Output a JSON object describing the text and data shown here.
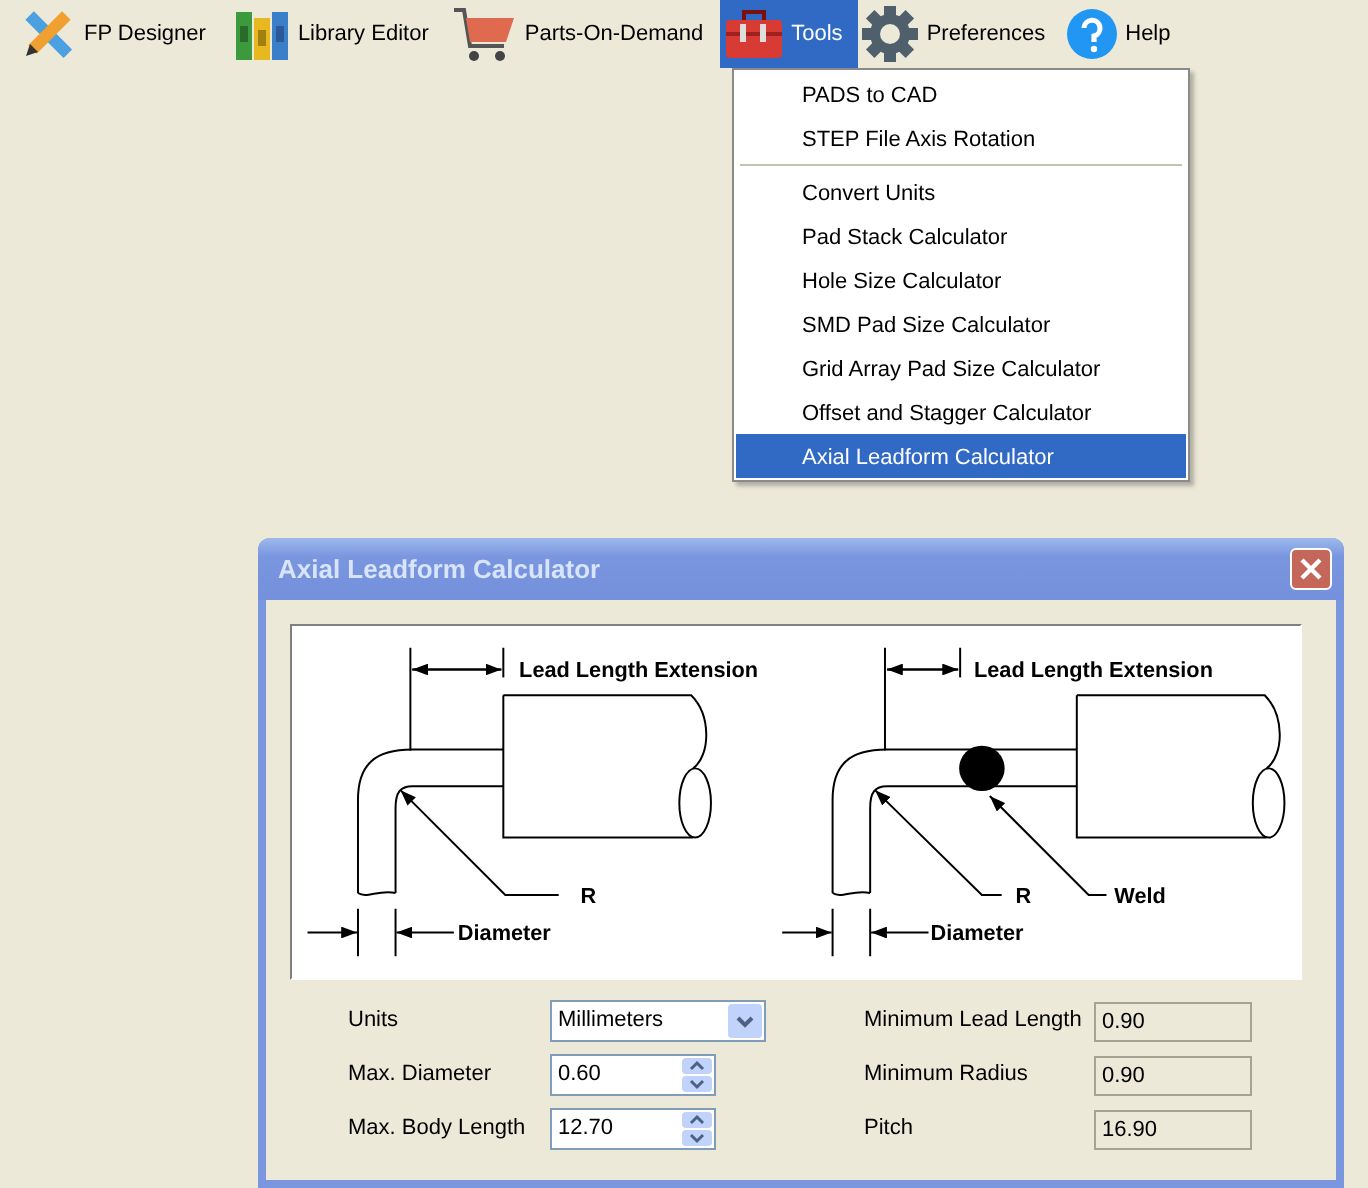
{
  "toolbar": [
    {
      "label": "FP Designer",
      "selected": false
    },
    {
      "label": "Library Editor",
      "selected": false
    },
    {
      "label": "Parts-On-Demand",
      "selected": false
    },
    {
      "label": "Tools",
      "selected": true
    },
    {
      "label": "Preferences",
      "selected": false
    },
    {
      "label": "Help",
      "selected": false
    }
  ],
  "tools_menu": [
    {
      "kind": "item",
      "label": "PADS to CAD",
      "selected": false
    },
    {
      "kind": "item",
      "label": "STEP File Axis Rotation",
      "selected": false
    },
    {
      "kind": "separator"
    },
    {
      "kind": "item",
      "label": "Convert Units",
      "selected": false
    },
    {
      "kind": "item",
      "label": "Pad Stack Calculator",
      "selected": false
    },
    {
      "kind": "item",
      "label": "Hole Size Calculator",
      "selected": false
    },
    {
      "kind": "item",
      "label": "SMD Pad Size Calculator",
      "selected": false
    },
    {
      "kind": "item",
      "label": "Grid Array Pad Size Calculator",
      "selected": false
    },
    {
      "kind": "item",
      "label": "Offset and Stagger Calculator",
      "selected": false
    },
    {
      "kind": "item",
      "label": "Axial Leadform Calculator",
      "selected": true
    }
  ],
  "dialog": {
    "title": "Axial Leadform Calculator",
    "diagram_labels": {
      "left_extension": "Lead Length Extension",
      "left_radius": "R",
      "left_diameter": "Diameter",
      "right_extension": "Lead Length Extension",
      "right_radius": "R",
      "weld": "Weld",
      "right_diameter": "Diameter"
    },
    "inputs": [
      {
        "kind": "dropdown",
        "label": "Units",
        "value": "Millimeters"
      },
      {
        "kind": "spinner",
        "label": "Max. Diameter",
        "value": "0.60"
      },
      {
        "kind": "spinner",
        "label": "Max. Body Length",
        "value": "12.70"
      }
    ],
    "results": [
      {
        "label": "Minimum Lead Length",
        "value": "0.90"
      },
      {
        "label": "Minimum Radius",
        "value": "0.90"
      },
      {
        "label": "Pitch",
        "value": "16.90"
      }
    ]
  }
}
